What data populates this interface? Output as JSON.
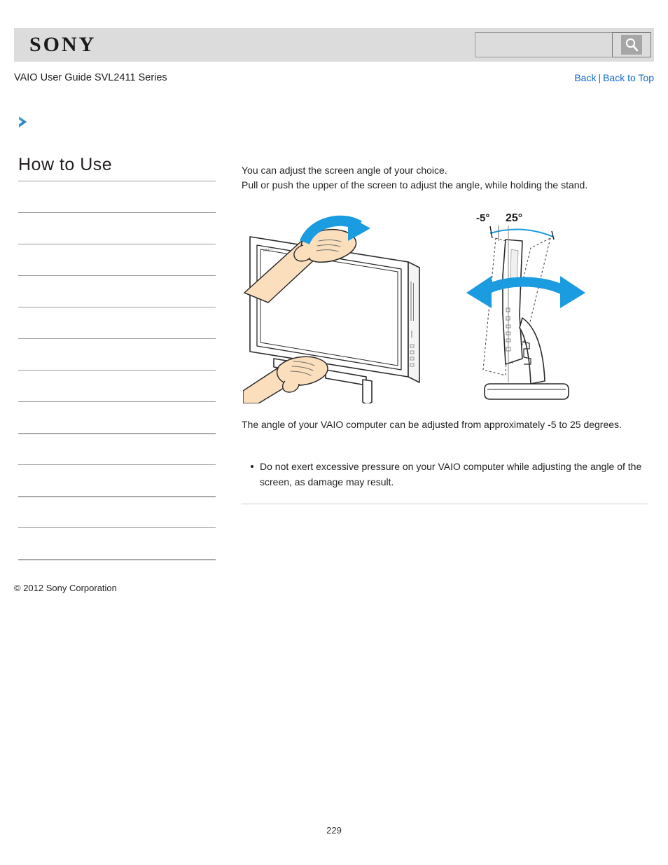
{
  "header": {
    "logo_text": "SONY",
    "search": {
      "value": "",
      "placeholder": "",
      "icon": "search-icon",
      "button_label": ""
    },
    "bg_color": "#dcdcdc"
  },
  "title_row": {
    "doc_title": "VAIO User Guide SVL2411 Series",
    "links": {
      "back": "Back",
      "separator": "|",
      "back_to_top": "Back to Top"
    },
    "link_color": "#1268cc"
  },
  "chevron": {
    "icon": "chevron-right-icon",
    "color_dark": "#2078c0",
    "color_light": "#63abdc"
  },
  "sidebar": {
    "heading": "How to Use",
    "items": [
      {
        "label": "",
        "divider": "thin"
      },
      {
        "label": "",
        "divider": "thin"
      },
      {
        "label": "",
        "divider": "thin"
      },
      {
        "label": "",
        "divider": "thin"
      },
      {
        "label": "",
        "divider": "thin"
      },
      {
        "label": "",
        "divider": "thin"
      },
      {
        "label": "",
        "divider": "thin"
      },
      {
        "label": "",
        "divider": "thin"
      },
      {
        "label": "",
        "divider": "thick"
      },
      {
        "label": "",
        "divider": "thin"
      },
      {
        "label": "",
        "divider": "thick"
      },
      {
        "label": "",
        "divider": "thin"
      },
      {
        "label": "",
        "divider": "thick"
      }
    ]
  },
  "content": {
    "intro_line_1": "You can adjust the screen angle of your choice.",
    "intro_line_2": "Pull or push the upper of the screen to adjust the angle, while holding the stand.",
    "angle_note": "The angle of your VAIO computer can be adjusted from approximately -5 to 25 degrees.",
    "caution_items": [
      "Do not exert excessive pressure on your VAIO computer while adjusting the angle of the screen, as damage may result."
    ],
    "figure_left": {
      "name": "vaio-tilt-hands-illustration",
      "arrow_color": "#1b9be0",
      "skin_color": "#fbdfbd"
    },
    "figure_right": {
      "name": "vaio-tilt-angle-side-illustration",
      "label_min": "-5°",
      "label_max": "25°",
      "arrow_color": "#1b9be0"
    }
  },
  "footer": {
    "copyright": "© 2012 Sony Corporation"
  },
  "page_number": "229"
}
